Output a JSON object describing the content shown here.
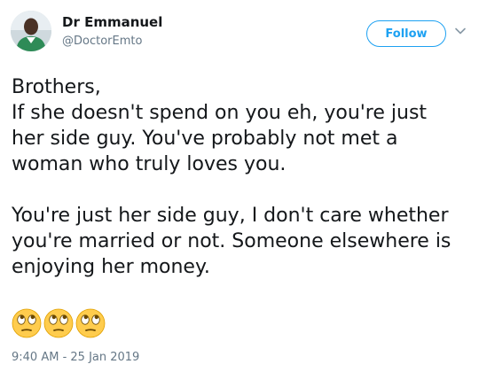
{
  "author": {
    "name": "Dr Emmanuel",
    "handle": "@DoctorEmto",
    "avatar_icon": "profile-photo"
  },
  "follow_button": {
    "label": "Follow",
    "color": "#1da1f2"
  },
  "tweet": {
    "lines_paragraph_1": [
      "Brothers,",
      "If she doesn't spend on you eh, you're just",
      "her side guy. You've probably not met a",
      "woman who truly loves you."
    ],
    "lines_paragraph_2": [
      "You're just her side guy, I don't care whether",
      "you're married or not. Someone elsewhere is",
      "enjoying her money."
    ],
    "emojis": [
      "face-with-rolling-eyes",
      "face-with-rolling-eyes",
      "face-with-rolling-eyes"
    ]
  },
  "timestamp": "9:40 AM - 25 Jan 2019"
}
